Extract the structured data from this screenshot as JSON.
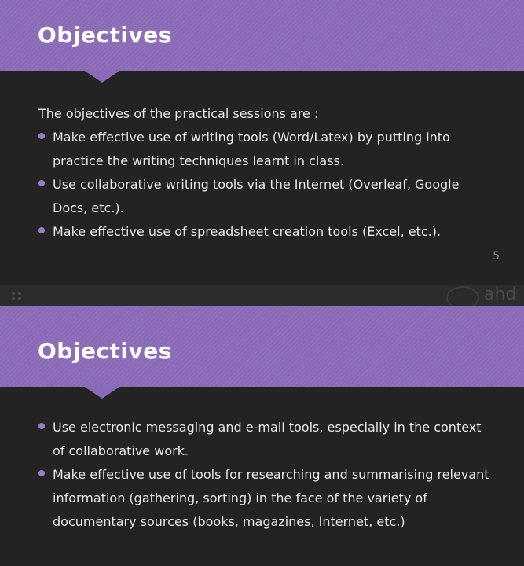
{
  "slides": [
    {
      "title": "Objectives",
      "intro": "The objectives of the practical sessions are :",
      "bullets": [
        "Make effective use of writing tools (Word/Latex) by putting into practice the writing techniques learnt in class.",
        "Use collaborative writing tools via the Internet (Overleaf, Google Docs, etc.).",
        "Make effective use of spreadsheet creation tools (Excel, etc.)."
      ],
      "page_number": "5"
    },
    {
      "title": "Objectives",
      "bullets": [
        "Use electronic messaging and e-mail tools, especially in the context of collaborative work.",
        "Make effective use of tools for researching and summarising relevant information (gathering, sorting) in the face of the variety of documentary sources (books, magazines, Internet, etc.)"
      ]
    }
  ],
  "watermark": {
    "text": "ahd",
    "icon": "logo-seal-icon"
  },
  "colors": {
    "accent": "#8b6bb8",
    "bullet": "#9a7fc6",
    "background": "#232323",
    "text": "#e8e8e8"
  }
}
